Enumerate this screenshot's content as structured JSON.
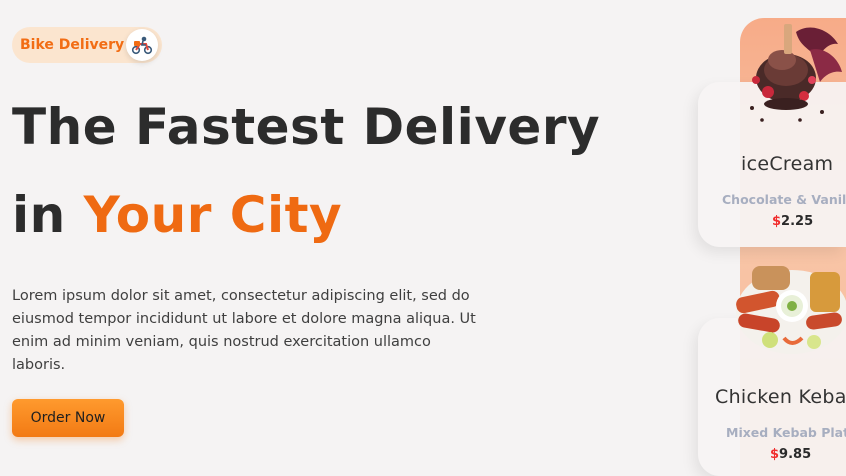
{
  "badge": {
    "label": "Bike Delivery",
    "icon": "delivery-scooter-icon"
  },
  "hero": {
    "title_line1": "The Fastest Delivery",
    "title_line2_prefix": "in",
    "title_line2_accent": "Your City",
    "description": "Lorem ipsum dolor sit amet, consectetur adipiscing elit, sed do eiusmod tempor incididunt ut labore et dolore magna aliqua. Ut enim ad minim veniam, quis nostrud exercitation ullamco laboris.",
    "cta_label": "Order Now"
  },
  "products": [
    {
      "name": "iceCream",
      "subtitle": "Chocolate & Vanill",
      "currency": "$",
      "price": "2.25",
      "image": "chocolate-icecream-image"
    },
    {
      "name": "Chicken Keba",
      "subtitle": "Mixed Kebab Plate",
      "currency": "$",
      "price": "9.85",
      "image": "kebab-plate-image"
    }
  ],
  "colors": {
    "accent": "#ef6a12",
    "badge_bg": "#fbe5cf",
    "cta": "#f7821b",
    "card_strip": "#f8c6a8",
    "price_currency": "#f02d2d",
    "subtitle": "#a7aec0",
    "background": "#f5f3f3"
  }
}
